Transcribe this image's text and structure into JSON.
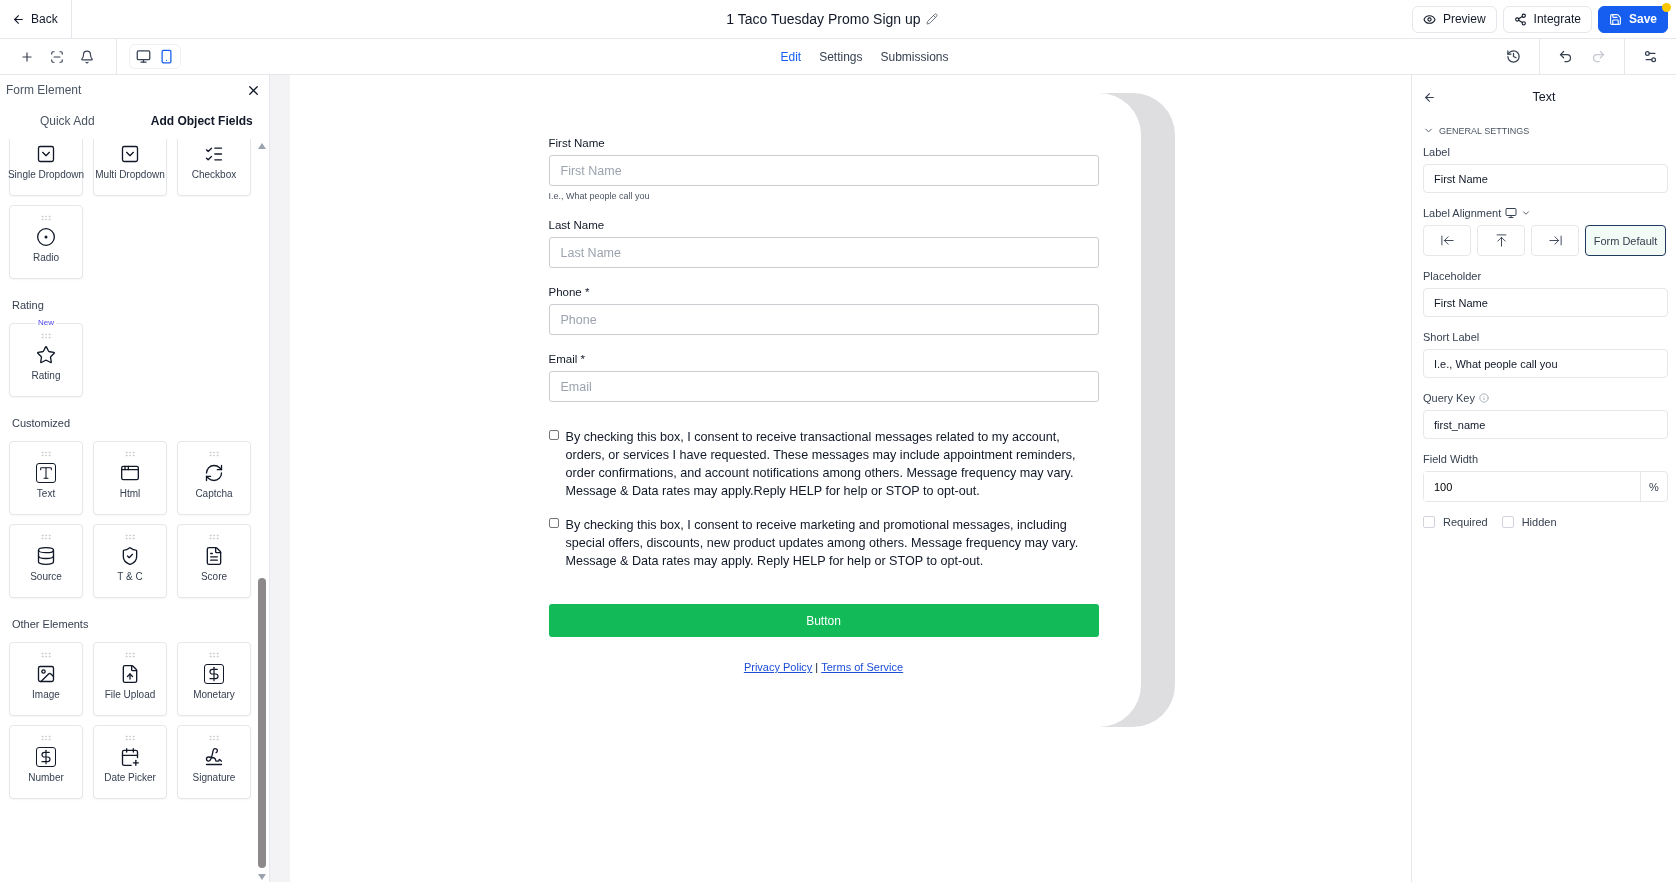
{
  "topbar": {
    "back": "Back",
    "title": "1 Taco Tuesday Promo Sign up",
    "actions": [
      {
        "kind": "preview",
        "label": "Preview",
        "notification": false
      },
      {
        "kind": "integrate",
        "label": "Integrate",
        "notification": false
      },
      {
        "kind": "save",
        "label": "Save",
        "notification": true
      }
    ]
  },
  "toolbar": {
    "devices": [
      {
        "kind": "desktop",
        "selected": false
      },
      {
        "kind": "mobile",
        "selected": true
      }
    ],
    "tabs": [
      {
        "label": "Edit",
        "selected": true
      },
      {
        "label": "Settings",
        "selected": false
      },
      {
        "label": "Submissions",
        "selected": false
      }
    ],
    "history": [
      {
        "kind": "undo",
        "disabled": false
      },
      {
        "kind": "redo",
        "disabled": true
      }
    ]
  },
  "sidebar": {
    "title": "Form Element",
    "tabs": [
      {
        "label": "Quick Add",
        "selected": false
      },
      {
        "label": "Add Object Fields",
        "selected": true
      }
    ],
    "sections": [
      {
        "items": [
          {
            "kind": "single_dropdown",
            "label": "Single Dropdown"
          },
          {
            "kind": "multi_dropdown",
            "label": "Multi Dropdown"
          },
          {
            "kind": "checkbox",
            "label": "Checkbox"
          },
          {
            "kind": "radio",
            "label": "Radio"
          }
        ]
      },
      {
        "title": "Rating",
        "items": [
          {
            "kind": "rating",
            "label": "Rating",
            "badge": "New"
          }
        ]
      },
      {
        "title": "Customized",
        "items": [
          {
            "kind": "text",
            "label": "Text"
          },
          {
            "kind": "html",
            "label": "Html"
          },
          {
            "kind": "captcha",
            "label": "Captcha"
          },
          {
            "kind": "source",
            "label": "Source"
          },
          {
            "kind": "tc",
            "label": "T & C"
          },
          {
            "kind": "score",
            "label": "Score"
          }
        ]
      },
      {
        "title": "Other Elements",
        "items": [
          {
            "kind": "image",
            "label": "Image"
          },
          {
            "kind": "file_upload",
            "label": "File Upload"
          },
          {
            "kind": "monetary",
            "label": "Monetary"
          },
          {
            "kind": "number",
            "label": "Number"
          },
          {
            "kind": "date_picker",
            "label": "Date Picker"
          },
          {
            "kind": "signature",
            "label": "Signature"
          }
        ]
      }
    ]
  },
  "form": {
    "fields": [
      {
        "label": "First Name",
        "placeholder": "First Name",
        "hint": "I.e., What people call you"
      },
      {
        "label": "Last Name",
        "placeholder": "Last Name"
      },
      {
        "label": "Phone *",
        "placeholder": "Phone"
      },
      {
        "label": "Email *",
        "placeholder": "Email"
      }
    ],
    "consents": [
      {
        "text": "By checking this box, I consent to receive transactional messages related to my account, orders, or services I have requested. These messages may include appointment reminders, order confirmations, and account notifications among others. Message frequency may vary. Message & Data rates may apply.Reply HELP for help or STOP to opt-out.",
        "checked": false
      },
      {
        "text": "By checking this box, I consent to receive marketing and promotional messages, including special offers, discounts, new product updates among others. Message frequency may vary. Message & Data rates may apply. Reply HELP for help or STOP to opt-out.",
        "checked": false
      }
    ],
    "button": "Button",
    "links": [
      "Privacy Policy",
      "Terms of Service"
    ],
    "separator": "|"
  },
  "properties": {
    "title": "Text",
    "section": {
      "title": "GENERAL SETTINGS",
      "expanded": true
    },
    "label": {
      "label": "Label",
      "value": "First Name"
    },
    "alignment": {
      "label": "Label Alignment",
      "options": [
        {
          "kind": "left",
          "selected": false
        },
        {
          "kind": "top",
          "selected": false
        },
        {
          "kind": "right",
          "selected": false
        },
        {
          "kind": "default",
          "label": "Form Default",
          "selected": true
        }
      ]
    },
    "placeholder": {
      "label": "Placeholder",
      "value": "First Name"
    },
    "short_label": {
      "label": "Short Label",
      "value": "I.e., What people call you"
    },
    "query_key": {
      "label": "Query Key",
      "value": "first_name"
    },
    "field_width": {
      "label": "Field Width",
      "value": "100",
      "unit": "%"
    },
    "options": [
      {
        "label": "Required",
        "checked": false
      },
      {
        "label": "Hidden",
        "checked": false
      }
    ]
  }
}
